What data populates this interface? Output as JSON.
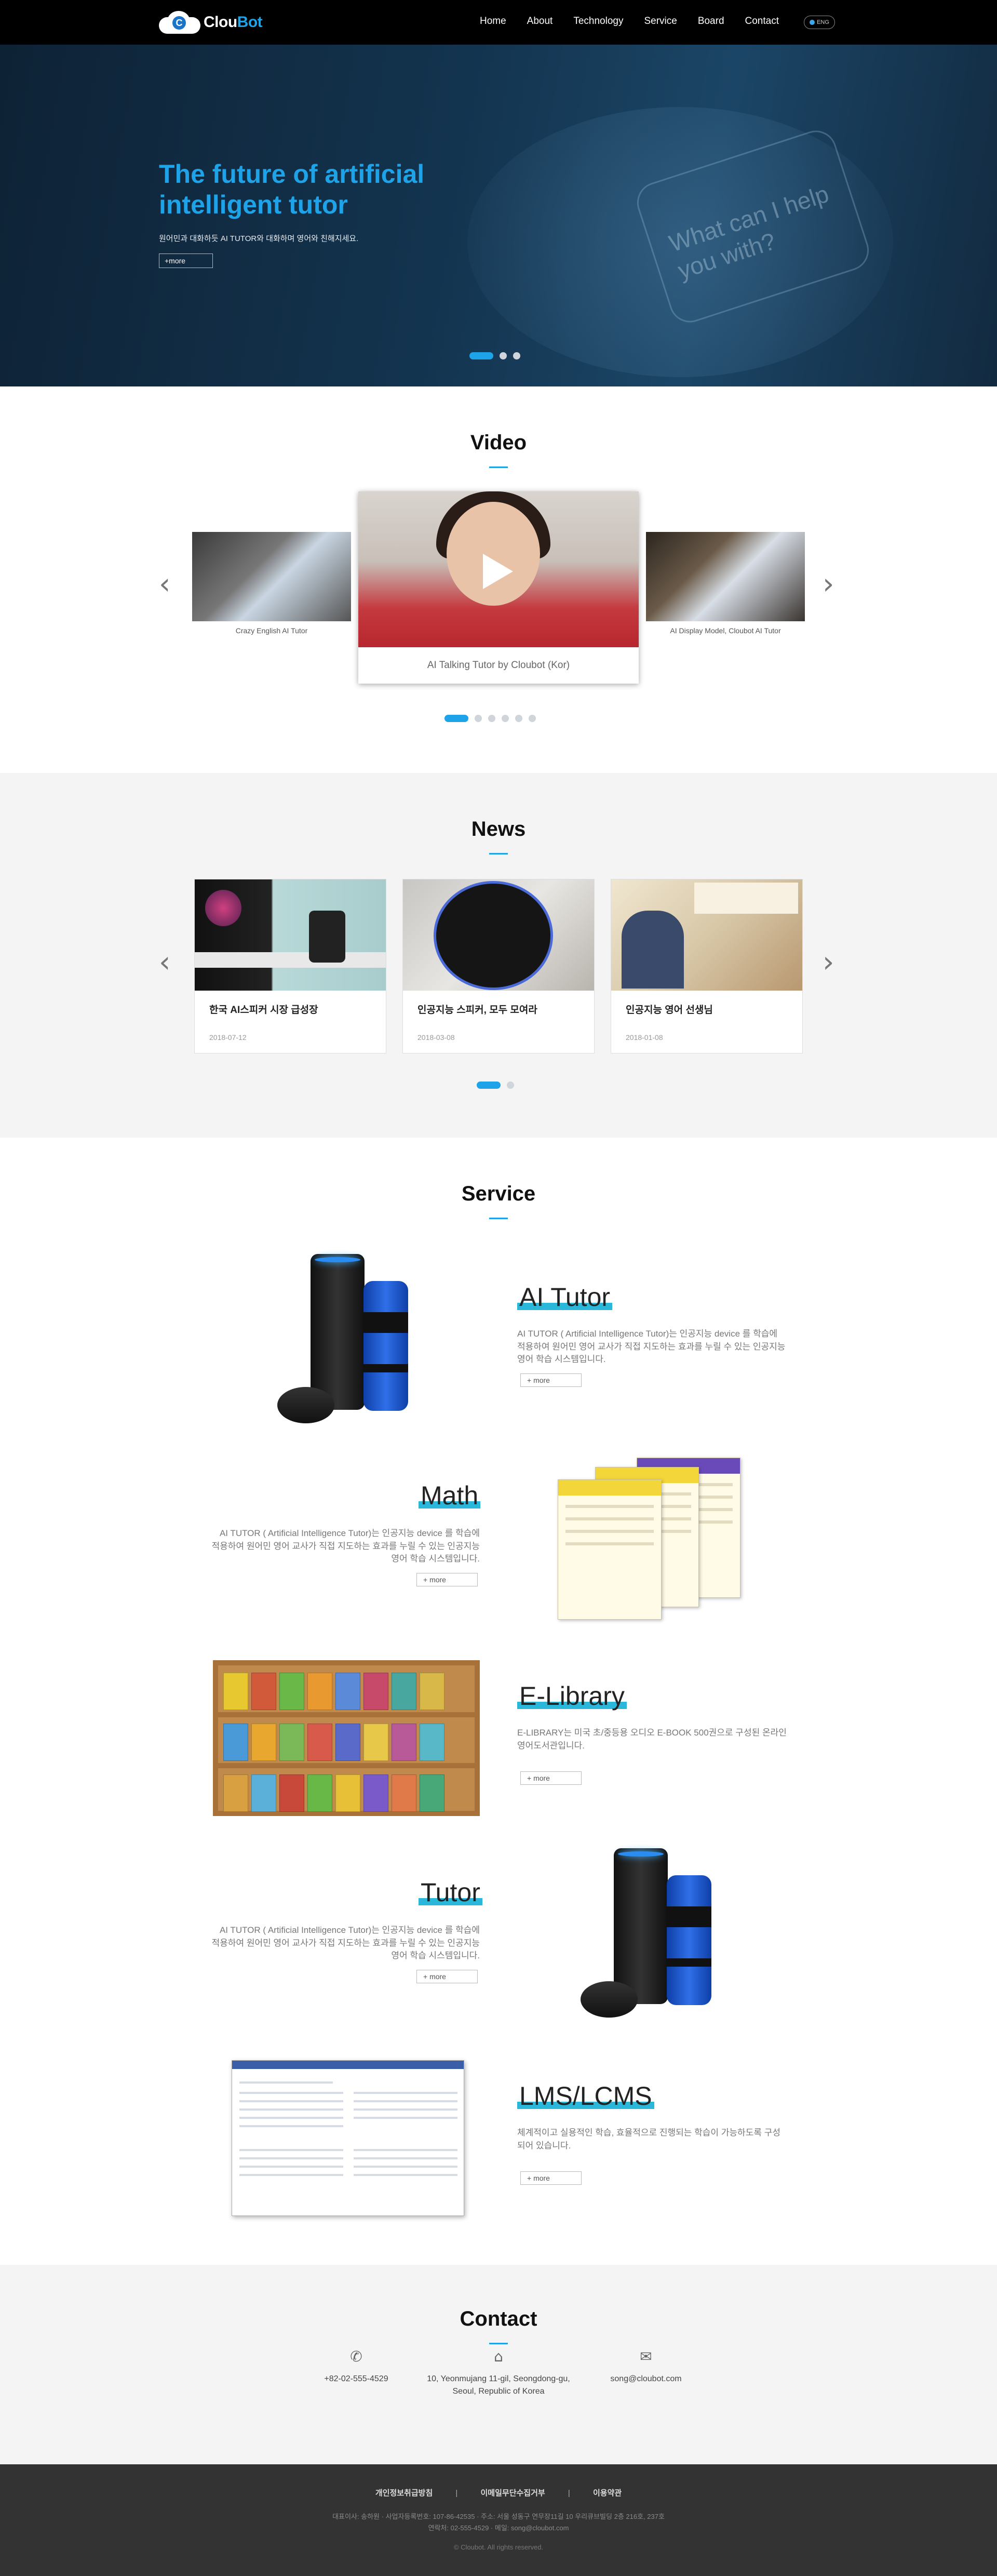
{
  "brand": {
    "cloud_letter": "C",
    "name_white": "Clou",
    "name_blue": "Bot"
  },
  "nav": {
    "items": [
      "Home",
      "About",
      "Technology",
      "Service",
      "Board",
      "Contact"
    ],
    "lang_label": "ENG"
  },
  "hero": {
    "title": "The future of artificial intelligent tutor",
    "subtitle": "원어민과 대화하듯 AI TUTOR와 대화하며 영어와 친해지세요.",
    "more_label": "+more",
    "bubble_text": "What can I help you with?",
    "slides_count": 3,
    "active_slide": 1
  },
  "video": {
    "title": "Video",
    "items": [
      {
        "caption": "Crazy English AI Tutor"
      },
      {
        "caption": "AI Talking Tutor by Cloubot (Kor)"
      },
      {
        "caption": "AI Display Model, Cloubot AI Tutor"
      }
    ],
    "slides_count": 6,
    "active_slide": 1
  },
  "news": {
    "title": "News",
    "items": [
      {
        "title": "한국 AI스피커 시장 급성장",
        "date": "2018-07-12"
      },
      {
        "title": "인공지능 스피커, 모두 모여라",
        "date": "2018-03-08"
      },
      {
        "title": "인공지능 영어 선생님",
        "date": "2018-01-08"
      }
    ],
    "slides_count": 2,
    "active_slide": 1
  },
  "service": {
    "title": "Service",
    "items": [
      {
        "name": "AI Tutor",
        "desc": "AI TUTOR ( Artificial Intelligence Tutor)는 인공지능 device 를 학습에 적용하여 원어민 영어 교사가 직접 지도하는 효과를 누릴 수 있는 인공지능 영어 학습 시스템입니다.",
        "more": "+ more"
      },
      {
        "name": "Math",
        "desc": "AI TUTOR ( Artificial Intelligence Tutor)는 인공지능 device 를 학습에 적용하여 원어민 영어 교사가 직접 지도하는 효과를 누릴 수 있는 인공지능 영어 학습 시스템입니다.",
        "more": "+ more"
      },
      {
        "name": "E-Library",
        "desc": "E-LIBRARY는 미국 초/중등용 오디오 E-BOOK 500권으로 구성된 온라인 영어도서관입니다.",
        "more": "+ more"
      },
      {
        "name": "Tutor",
        "desc": "AI TUTOR ( Artificial Intelligence Tutor)는 인공지능 device 를 학습에 적용하여 원어민 영어 교사가 직접 지도하는 효과를 누릴 수 있는 인공지능 영어 학습 시스템입니다.",
        "more": "+ more"
      },
      {
        "name": "LMS/LCMS",
        "desc": "체계적이고 실용적인 학습, 효율적으로 진행되는 학습이 가능하도록 구성되어 있습니다.",
        "more": "+ more"
      }
    ]
  },
  "contact": {
    "title": "Contact",
    "phone": "+82-02-555-4529",
    "address_line1": "10, Yeonmujang 11-gil, Seongdong-gu,",
    "address_line2": "Seoul, Republic of Korea",
    "email": "song@cloubot.com"
  },
  "footer": {
    "links": [
      "개인정보취급방침",
      "이메일무단수집거부",
      "이용약관"
    ],
    "address_line1": "대표이사: 송하원 · 사업자등록번호: 107-86-42535 · 주소: 서울 성동구 연무장11길 10 우리큐브빌딩 2층 216호, 237호",
    "address_line2": "연락처: 02-555-4529 · 메일: song@cloubot.com",
    "copyright": "© Cloubot. All rights reserved."
  },
  "colors": {
    "accent": "#1fa3e8",
    "highlight": "#2ab7d9",
    "nav_bg": "#000000",
    "footer_bg": "#333333"
  }
}
